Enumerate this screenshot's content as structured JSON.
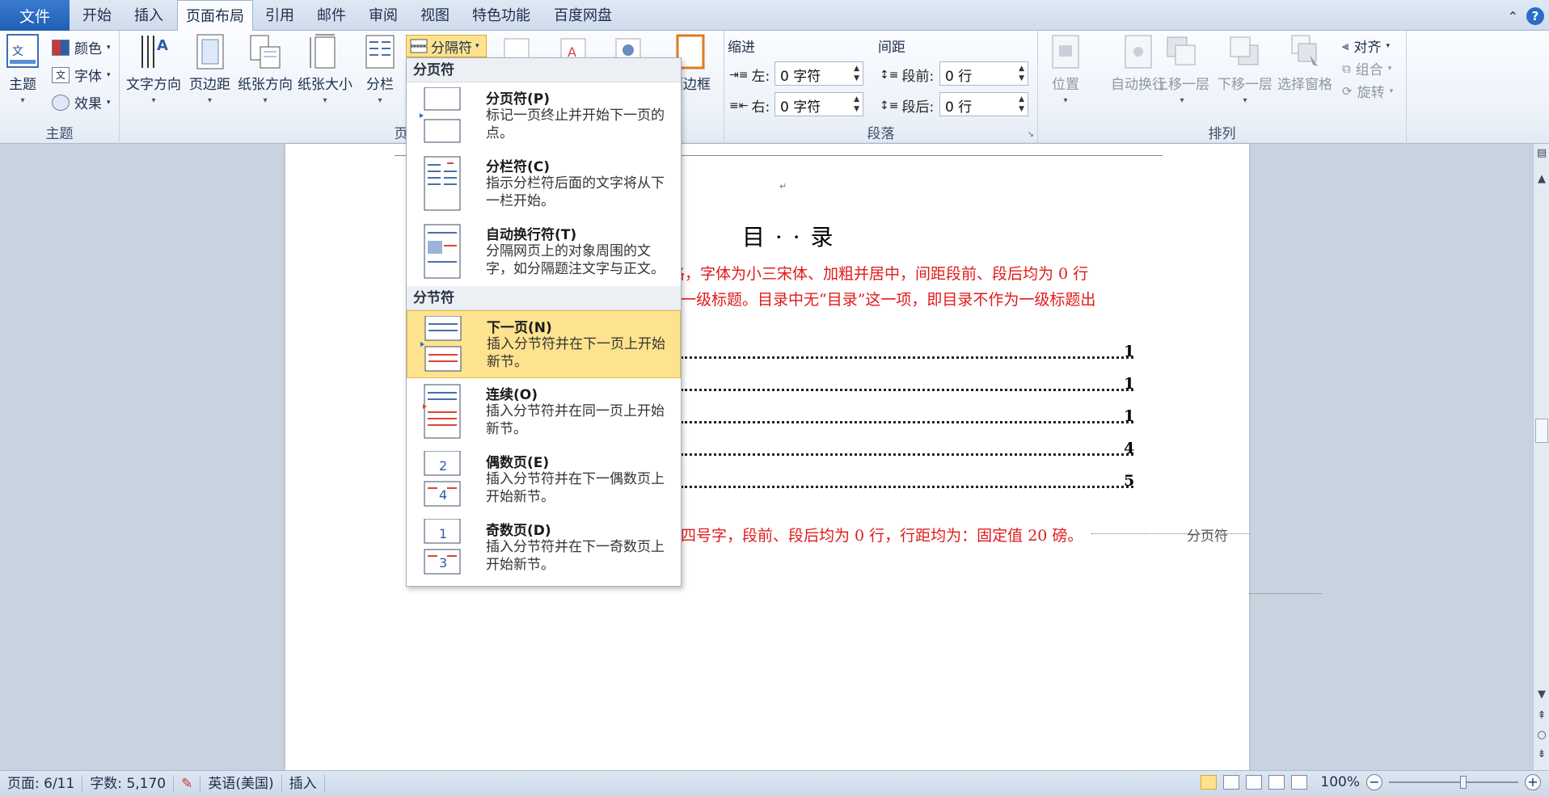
{
  "tabs": {
    "file": "文件",
    "items": [
      "开始",
      "插入",
      "页面布局",
      "引用",
      "邮件",
      "审阅",
      "视图",
      "特色功能",
      "百度网盘"
    ],
    "active": "页面布局"
  },
  "ribbon": {
    "theme": {
      "label": "主题",
      "main": "主题",
      "colors": "颜色",
      "fonts": "字体",
      "effects": "效果"
    },
    "page_setup": {
      "label": "页面设置",
      "text_direction": "文字方向",
      "margins": "页边距",
      "orientation": "纸张方向",
      "size": "纸张大小",
      "columns": "分栏",
      "breaks": "分隔符",
      "page_border": "面边框"
    },
    "paragraph": {
      "label": "段落",
      "indent_title": "缩进",
      "spacing_title": "间距",
      "left_label": "左:",
      "right_label": "右:",
      "left_value": "0 字符",
      "right_value": "0 字符",
      "before_label": "段前:",
      "after_label": "段后:",
      "before_value": "0 行",
      "after_value": "0 行"
    },
    "arrange": {
      "label": "排列",
      "position": "位置",
      "wrap": "自动换行",
      "bring_forward": "上移一层",
      "send_backward": "下移一层",
      "selection_pane": "选择窗格",
      "align": "对齐",
      "group": "组合",
      "rotate": "旋转"
    }
  },
  "menu": {
    "section1": "分页符",
    "section2": "分节符",
    "items": [
      {
        "title": "分页符(P)",
        "desc": "标记一页终止并开始下一页的点。"
      },
      {
        "title": "分栏符(C)",
        "desc": "指示分栏符后面的文字将从下一栏开始。"
      },
      {
        "title": "自动换行符(T)",
        "desc": "分隔网页上的对象周围的文字，如分隔题注文字与正文。"
      },
      {
        "title": "下一页(N)",
        "desc": "插入分节符并在下一页上开始新节。"
      },
      {
        "title": "连续(O)",
        "desc": "插入分节符并在同一页上开始新节。"
      },
      {
        "title": "偶数页(E)",
        "desc": "插入分节符并在下一偶数页上开始新节。"
      },
      {
        "title": "奇数页(D)",
        "desc": "插入分节符并在下一奇数页上开始新节。"
      }
    ]
  },
  "document": {
    "title": "目 · · 录",
    "red_line1": "格，字体为小三宋体、加粗并居中，间距段前、段后均为 0 行",
    "red_line2": "一级标题。目录中无“目录”这一项，即目录不作为一级标题出",
    "red_line3": "四号字，段前、段后均为 0 行，行距均为：固定值 20 磅。",
    "page_break_label": "分页符",
    "toc_numbers": [
      "1",
      "1",
      "1",
      "4",
      "5"
    ]
  },
  "status": {
    "page": "页面: 6/11",
    "words": "字数: 5,170",
    "language": "英语(美国)",
    "mode": "插入",
    "zoom": "100%"
  }
}
